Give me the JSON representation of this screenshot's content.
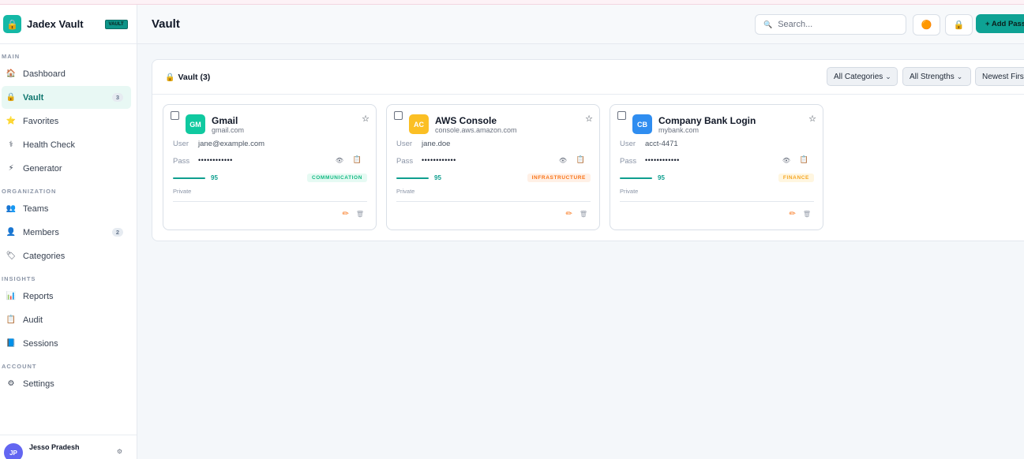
{
  "brand": {
    "title": "Jadex Vault",
    "badge": "VAULT"
  },
  "sidebar": {
    "sections": [
      {
        "label": "MAIN",
        "items": [
          {
            "label": "Dashboard",
            "icon": "house-icon",
            "count": ""
          },
          {
            "label": "Vault",
            "icon": "lock-icon",
            "count": "3",
            "active": true
          },
          {
            "label": "Favorites",
            "icon": "star-icon",
            "count": ""
          },
          {
            "label": "Health Check",
            "icon": "stethoscope-icon",
            "count": ""
          },
          {
            "label": "Generator",
            "icon": "lightning-icon",
            "count": ""
          }
        ]
      },
      {
        "label": "ORGANIZATION",
        "items": [
          {
            "label": "Teams",
            "icon": "people-icon",
            "count": ""
          },
          {
            "label": "Members",
            "icon": "person-icon",
            "count": "2"
          },
          {
            "label": "Categories",
            "icon": "tag-icon",
            "count": ""
          }
        ]
      },
      {
        "label": "INSIGHTS",
        "items": [
          {
            "label": "Reports",
            "icon": "bar-chart-icon",
            "count": ""
          },
          {
            "label": "Audit",
            "icon": "clipboard-icon",
            "count": ""
          },
          {
            "label": "Sessions",
            "icon": "book-icon",
            "count": ""
          }
        ]
      },
      {
        "label": "ACCOUNT",
        "items": [
          {
            "label": "Settings",
            "icon": "gear-icon",
            "count": ""
          }
        ]
      }
    ],
    "user": {
      "initials": "JP",
      "name": "Jesso Pradesh"
    }
  },
  "header": {
    "title": "Vault",
    "search_placeholder": "Search...",
    "add_label": "+ Add Password"
  },
  "panel": {
    "title": "Vault (3)",
    "filters": [
      "All Categories",
      "All Strengths",
      "Newest First"
    ]
  },
  "cards": [
    {
      "initials": "GM",
      "name": "Gmail",
      "domain": "gmail.com",
      "user_label": "User",
      "user": "jane@example.com",
      "pass_label": "Pass",
      "pass": "••••••••••••",
      "score": "95",
      "tag": "COMMUNICATION",
      "visibility": "Private",
      "logo_color": "#10c9a0",
      "tag_color": "#10b981",
      "tag_bg": "#e6faf3"
    },
    {
      "initials": "AC",
      "name": "AWS Console",
      "domain": "console.aws.amazon.com",
      "user_label": "User",
      "user": "jane.doe",
      "pass_label": "Pass",
      "pass": "••••••••••••",
      "score": "95",
      "tag": "INFRASTRUCTURE",
      "visibility": "Private",
      "logo_color": "#fbbf24",
      "tag_color": "#f97316",
      "tag_bg": "#fff0e6"
    },
    {
      "initials": "CB",
      "name": "Company Bank Login",
      "domain": "mybank.com",
      "user_label": "User",
      "user": "acct-4471",
      "pass_label": "Pass",
      "pass": "••••••••••••",
      "score": "95",
      "tag": "FINANCE",
      "visibility": "Private",
      "logo_color": "#2f8df0",
      "tag_color": "#f5a623",
      "tag_bg": "#fff6e0"
    }
  ]
}
